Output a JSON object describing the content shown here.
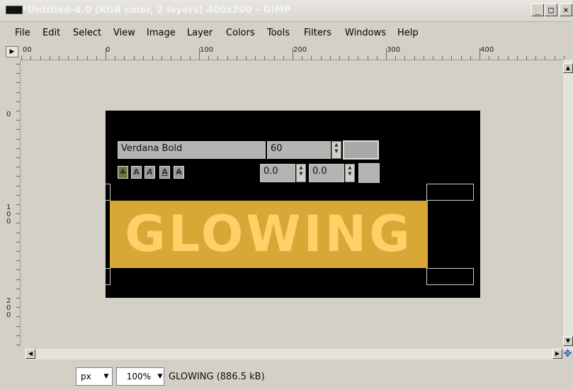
{
  "window": {
    "title": "*Untitled-4.0 (RGB color, 2 layers) 400x200 – GIMP",
    "minimize": "_",
    "maximize": "□",
    "close": "×"
  },
  "menu": {
    "items": [
      "File",
      "Edit",
      "Select",
      "View",
      "Image",
      "Layer",
      "Colors",
      "Tools",
      "Filters",
      "Windows",
      "Help"
    ]
  },
  "ruler": {
    "h_labels": [
      "00",
      "0",
      "100",
      "200",
      "300",
      "400"
    ],
    "v_labels": [
      "0",
      "1\n0\n0",
      "2\n0\n0"
    ]
  },
  "text_tool": {
    "font": "Verdana Bold",
    "size": "60",
    "offset_x": "0.0",
    "offset_y": "0.0"
  },
  "canvas": {
    "text": "GLOWING",
    "text_color": "#fdd068",
    "glow_color": "#d8a837",
    "background": "#000000"
  },
  "status": {
    "unit": "px",
    "zoom": "100%",
    "info": "GLOWING (886.5 kB)"
  }
}
